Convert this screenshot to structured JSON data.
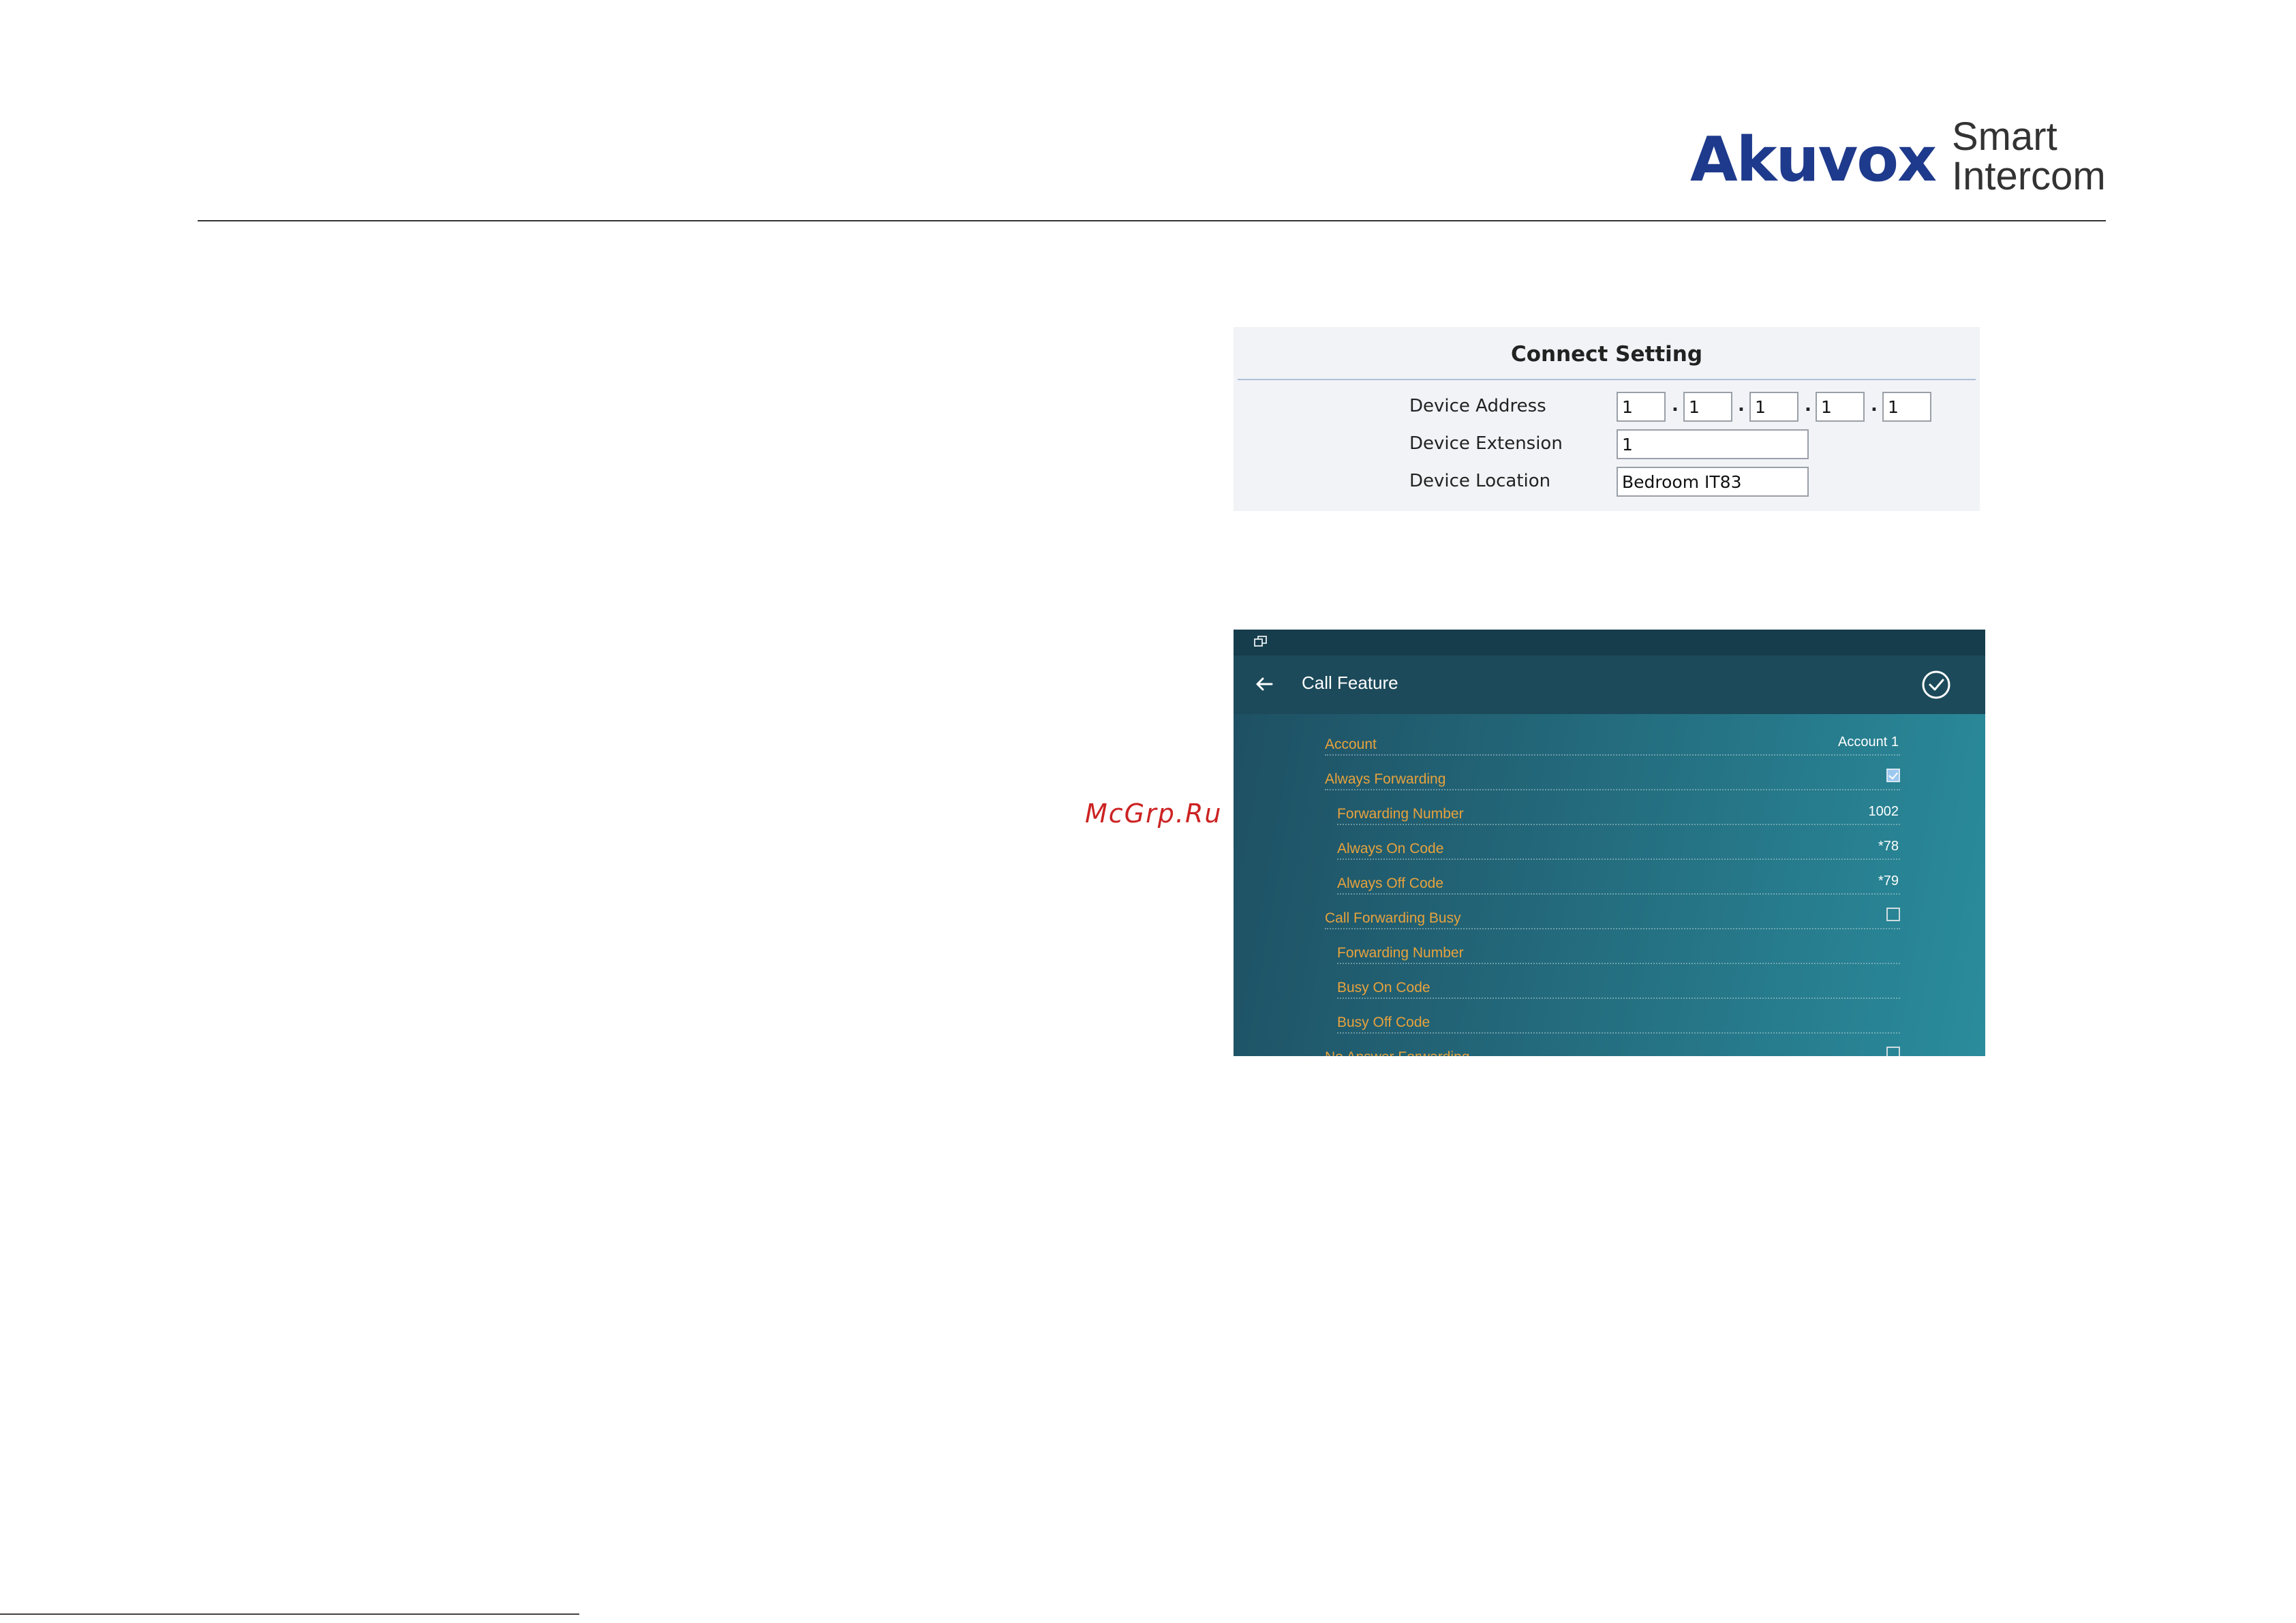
{
  "brand": {
    "name": "Akuvox",
    "tagline_line1": "Smart",
    "tagline_line2": "Intercom",
    "color": "#1e3a8c"
  },
  "watermark": "McGrp.Ru",
  "connect_setting": {
    "title": "Connect Setting",
    "device_address": {
      "label": "Device Address",
      "octets": [
        "1",
        "1",
        "1",
        "1",
        "1"
      ]
    },
    "device_extension": {
      "label": "Device Extension",
      "value": "1"
    },
    "device_location": {
      "label": "Device Location",
      "value": "Bedroom IT83"
    }
  },
  "call_feature": {
    "title": "Call Feature",
    "icons": {
      "status": "window-restore-icon",
      "back": "back-arrow-icon",
      "confirm": "check-circle-icon"
    },
    "accent_color": "#e8a23c",
    "rows": [
      {
        "label": "Account",
        "value": "Account 1",
        "type": "value",
        "indent": false
      },
      {
        "label": "Always Forwarding",
        "type": "checkbox",
        "checked": true,
        "indent": false
      },
      {
        "label": "Forwarding Number",
        "value": "1002",
        "type": "value",
        "indent": true
      },
      {
        "label": "Always On Code",
        "value": "*78",
        "type": "value",
        "indent": true
      },
      {
        "label": "Always Off Code",
        "value": "*79",
        "type": "value",
        "indent": true
      },
      {
        "label": "Call Forwarding Busy",
        "type": "checkbox",
        "checked": false,
        "indent": false
      },
      {
        "label": "Forwarding Number",
        "value": "",
        "type": "value",
        "indent": true
      },
      {
        "label": "Busy On Code",
        "value": "",
        "type": "value",
        "indent": true
      },
      {
        "label": "Busy Off Code",
        "value": "",
        "type": "value",
        "indent": true
      },
      {
        "label": "No Answer Forwarding",
        "type": "checkbox",
        "checked": false,
        "indent": false
      }
    ]
  }
}
